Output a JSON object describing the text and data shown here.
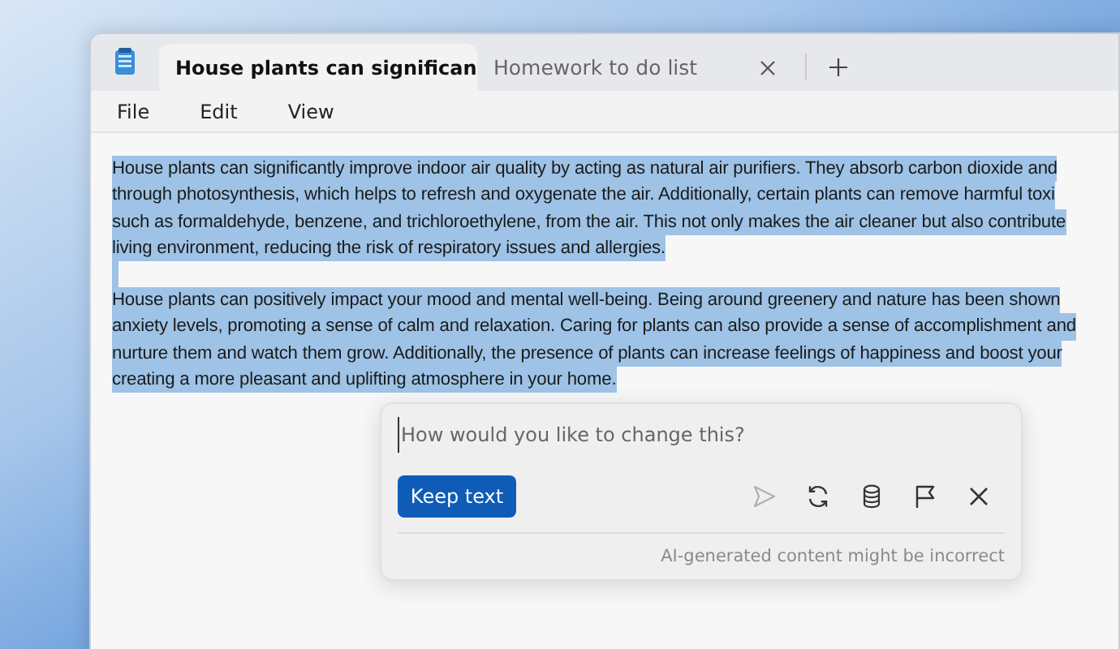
{
  "tabs": [
    {
      "label": "House plants can significan",
      "selected": true,
      "closable": false
    },
    {
      "label": "Homework to do list",
      "selected": false,
      "closable": true
    }
  ],
  "menu": [
    "File",
    "Edit",
    "View"
  ],
  "paragraphs": [
    {
      "selected": true,
      "lines": [
        "House plants can significantly improve indoor air quality by acting as natural air purifiers. They absorb carbon dioxide and",
        "through photosynthesis, which helps to refresh and oxygenate the air. Additionally, certain plants can remove harmful toxi",
        "such as formaldehyde, benzene, and trichloroethylene, from the air. This not only makes the air cleaner but also contribute",
        "living environment, reducing the risk of respiratory issues and allergies."
      ]
    },
    {
      "selected": true,
      "lines": [
        "House plants can positively impact your mood and mental well-being. Being around greenery and nature has been shown",
        "anxiety levels, promoting a sense of calm and relaxation. Caring for plants can also provide a sense of accomplishment and",
        "nurture them and watch them grow. Additionally, the presence of plants can increase feelings of happiness and boost your",
        "creating a more pleasant and uplifting atmosphere in your home."
      ]
    }
  ],
  "rewrite_panel": {
    "placeholder": "How would you like to change this?",
    "button": "Keep text",
    "send_disabled": true,
    "disclaimer": "AI-generated content might be incorrect"
  }
}
